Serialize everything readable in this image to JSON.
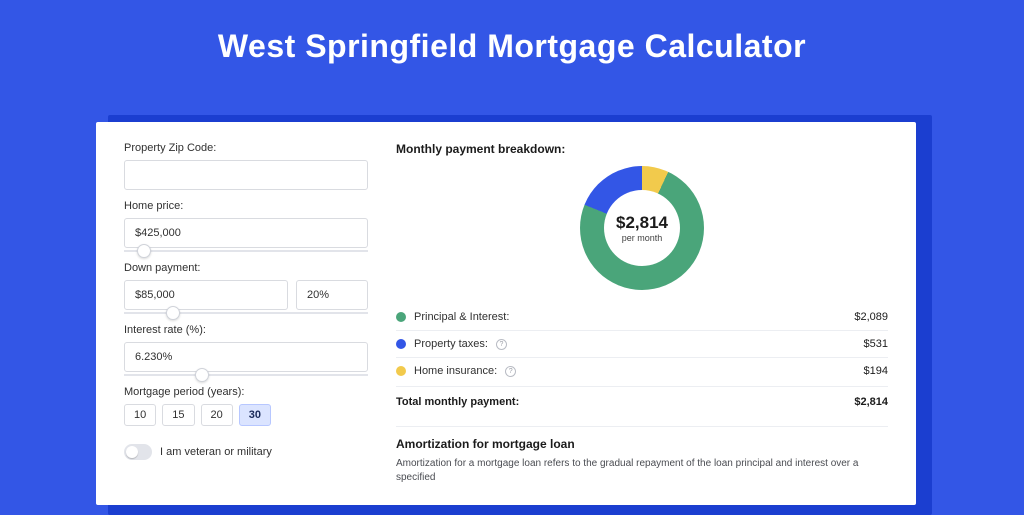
{
  "title": "West Springfield Mortgage Calculator",
  "form": {
    "zip": {
      "label": "Property Zip Code:",
      "value": ""
    },
    "price": {
      "label": "Home price:",
      "value": "$425,000",
      "slider_pct": 8
    },
    "down": {
      "label": "Down payment:",
      "amount": "$85,000",
      "pct": "20%",
      "slider_pct": 20
    },
    "rate": {
      "label": "Interest rate (%):",
      "value": "6.230%",
      "slider_pct": 32
    },
    "period": {
      "label": "Mortgage period (years):",
      "options": [
        "10",
        "15",
        "20",
        "30"
      ],
      "selected": "30"
    },
    "veteran_label": "I am veteran or military"
  },
  "breakdown": {
    "title": "Monthly payment breakdown:",
    "center_amount": "$2,814",
    "center_sub": "per month",
    "items": [
      {
        "color": "green",
        "label": "Principal & Interest:",
        "info": false,
        "value": "$2,089"
      },
      {
        "color": "blue",
        "label": "Property taxes:",
        "info": true,
        "value": "$531"
      },
      {
        "color": "yellow",
        "label": "Home insurance:",
        "info": true,
        "value": "$194"
      }
    ],
    "total_label": "Total monthly payment:",
    "total_value": "$2,814"
  },
  "amortization": {
    "title": "Amortization for mortgage loan",
    "body": "Amortization for a mortgage loan refers to the gradual repayment of the loan principal and interest over a specified"
  },
  "chart_data": {
    "type": "pie",
    "title": "Monthly payment breakdown",
    "series": [
      {
        "name": "Principal & Interest",
        "value": 2089,
        "color": "#4aa57a"
      },
      {
        "name": "Property taxes",
        "value": 531,
        "color": "#3356e6"
      },
      {
        "name": "Home insurance",
        "value": 194,
        "color": "#f2ca4c"
      }
    ],
    "total": 2814,
    "unit": "USD per month"
  }
}
